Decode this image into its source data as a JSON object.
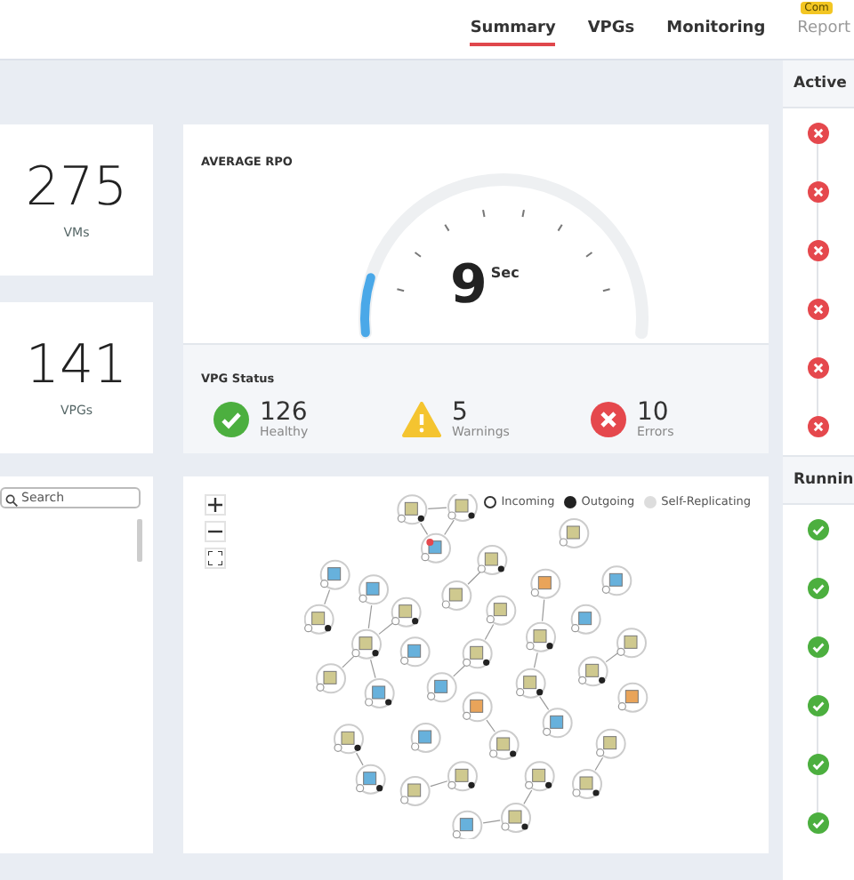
{
  "nav": {
    "tabs": [
      {
        "label": "Summary",
        "selected": true
      },
      {
        "label": "VPGs",
        "selected": false
      },
      {
        "label": "Monitoring",
        "selected": false
      },
      {
        "label": "Report",
        "selected": false,
        "badge": "Com"
      }
    ]
  },
  "stats": [
    {
      "value": "275",
      "label": "VMs"
    },
    {
      "value": "141",
      "label": "VPGs"
    }
  ],
  "search": {
    "placeholder": "Search"
  },
  "rpo": {
    "title": "AVERAGE RPO",
    "value": "9",
    "unit": "Sec",
    "level": 0.12
  },
  "vpg_status": {
    "title": "VPG Status",
    "items": [
      {
        "kind": "healthy",
        "count": "126",
        "label": "Healthy"
      },
      {
        "kind": "warning",
        "count": "5",
        "label": "Warnings"
      },
      {
        "kind": "error",
        "count": "10",
        "label": "Errors"
      }
    ]
  },
  "topology": {
    "legend": [
      {
        "kind": "incoming",
        "label": "Incoming"
      },
      {
        "kind": "outgoing",
        "label": "Outgoing"
      },
      {
        "kind": "self",
        "label": "Self-Replicating"
      }
    ]
  },
  "side_panels": [
    {
      "title": "Active",
      "items": [
        {
          "kind": "error"
        },
        {
          "kind": "error"
        },
        {
          "kind": "error"
        },
        {
          "kind": "error"
        },
        {
          "kind": "error"
        },
        {
          "kind": "error"
        }
      ]
    },
    {
      "title": "Runnin",
      "items": [
        {
          "kind": "success"
        },
        {
          "kind": "success"
        },
        {
          "kind": "success"
        },
        {
          "kind": "success"
        },
        {
          "kind": "success"
        },
        {
          "kind": "success"
        }
      ]
    }
  ]
}
